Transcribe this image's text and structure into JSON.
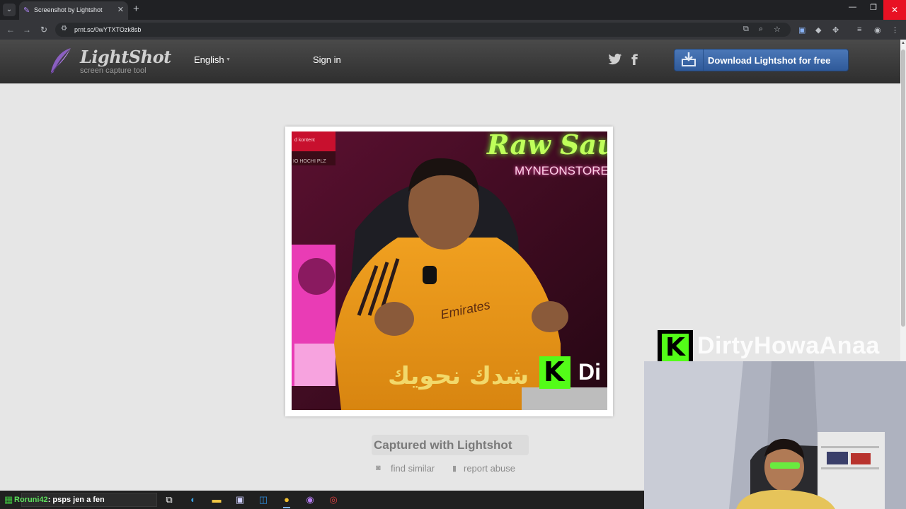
{
  "browser": {
    "tab_title": "Screenshot by Lightshot",
    "tab_close": "✕",
    "new_tab": "+",
    "url": "prnt.sc/0wYTXTOzk8sb",
    "window_controls": [
      "—",
      "❐",
      "✕"
    ]
  },
  "lightshot": {
    "logo_text": "LightShot",
    "logo_subtitle": "screen capture tool",
    "language": "English",
    "sign_in": "Sign in",
    "download_button": "Download Lightshot for free",
    "caption": "Captured with Lightshot",
    "find_similar": "find similar",
    "report_abuse": "report abuse"
  },
  "screenshot_content": {
    "neon_sign_1": "Raw Sauce",
    "neon_sign_2": "MYNEONSTORE",
    "corner_label_1": "d kontent",
    "corner_label_2": "IO HOCHI PLZ",
    "arabic_caption": "شدك نحويك",
    "kick_letter": "K",
    "kick_partial": "Di",
    "jersey_text": "Emirates"
  },
  "overlay": {
    "kick_letter": "K",
    "streamer_name": "DirtyHowaAnaa"
  },
  "taskbar": {
    "search_user": "Roruni42",
    "search_text": ": psps jen a fen"
  },
  "colors": {
    "kick_green": "#53fc18",
    "download_blue": "#3a67a8",
    "close_red": "#e81123"
  }
}
